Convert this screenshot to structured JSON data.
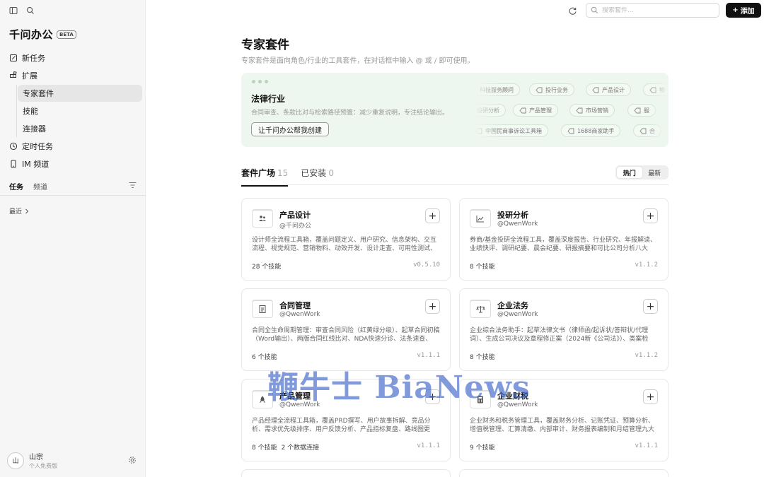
{
  "app": {
    "name": "千问办公",
    "beta": "BETA"
  },
  "nav": {
    "new_task": "新任务",
    "extensions": "扩展",
    "sub": [
      "专家套件",
      "技能",
      "连接器"
    ],
    "scheduled": "定时任务",
    "im": "IM 频道"
  },
  "sidebar_tabs": {
    "tasks": "任务",
    "channels": "频道"
  },
  "recent": "最近",
  "user": {
    "name": "山宗",
    "plan": "个人免费版",
    "initial": "山"
  },
  "search": {
    "placeholder": "搜索套件..."
  },
  "add_button": "添加",
  "page": {
    "title": "专家套件",
    "desc": "专家套件是面向角色/行业的工具套件，在对话框中输入 @ 或 / 即可使用。"
  },
  "banner": {
    "title": "法律行业",
    "desc": "合同审查、条款比对与检索路径预置：减少重复说明，专注结论输出。",
    "button": "让千问办公帮我创建",
    "chips_row1": [
      "科技服务顾问",
      "投行业务",
      "产品设计",
      "物"
    ],
    "chips_row2": [
      "投研分析",
      "产品管理",
      "市场营销",
      "服"
    ],
    "chips_row3": [
      "中国民商事诉讼工具箱",
      "1688商家助手",
      "合"
    ]
  },
  "tabs": [
    {
      "label": "套件广场",
      "count": "15"
    },
    {
      "label": "已安装",
      "count": "0"
    }
  ],
  "sort": {
    "hot": "热门",
    "new": "最新"
  },
  "cards": [
    {
      "name": "产品设计",
      "author": "@千问办公",
      "desc": "设计师全流程工具箱，覆盖问题定义、用户研究、信息架构、交互流程、视觉规范、营销物料、动效开发、设计走查、可用性测试、工...",
      "skills": "28 个技能",
      "extra": "",
      "version": "v0.5.10",
      "icon": "people-icon"
    },
    {
      "name": "投研分析",
      "author": "@QwenWork",
      "desc": "券商/基金投研全流程工具，覆盖深度报告、行业研究、年报解读、业绩快评、调研纪要、晨会纪要、研报摘要和可比公司分析八大场...",
      "skills": "8 个技能",
      "extra": "",
      "version": "v1.1.2",
      "icon": "chart-icon"
    },
    {
      "name": "合同管理",
      "author": "@QwenWork",
      "desc": "合同全生命周期管理：审查合同风险（红黄绿分级）、起草合同初稿（Word输出）、两版合同红线比对、NDA快速分诊、法条速查、合...",
      "skills": "6 个技能",
      "extra": "",
      "version": "v1.1.1",
      "icon": "document-icon"
    },
    {
      "name": "企业法务",
      "author": "@QwenWork",
      "desc": "企业综合法务助手：起草法律文书（律师函/起诉状/答辩状/代理词）、生成公司决议及章程修正案（2024新《公司法》）、类案检索...",
      "skills": "8 个技能",
      "extra": "",
      "version": "v1.1.2",
      "icon": "scale-icon"
    },
    {
      "name": "产品管理",
      "author": "@QwenWork",
      "desc": "产品经理全流程工具箱，覆盖PRD撰写、用户故事拆解、竞品分析、需求优先级排序、用户反馈分析、产品指标复盘、路线图更新...",
      "skills": "8 个技能",
      "extra": "2 个数据连接",
      "version": "v1.1.1",
      "icon": "rocket-icon"
    },
    {
      "name": "企业财税",
      "author": "@QwenWork",
      "desc": "企业财务和税务管理工具，覆盖财务分析、记账凭证、预算分析、增值税管理、汇算清缴、内部审计、财务报表编制和月结管理九大场...",
      "skills": "9 个技能",
      "extra": "",
      "version": "v1.1.1",
      "icon": "calculator-icon"
    }
  ],
  "watermark": "鞭牛士 BiaNews"
}
